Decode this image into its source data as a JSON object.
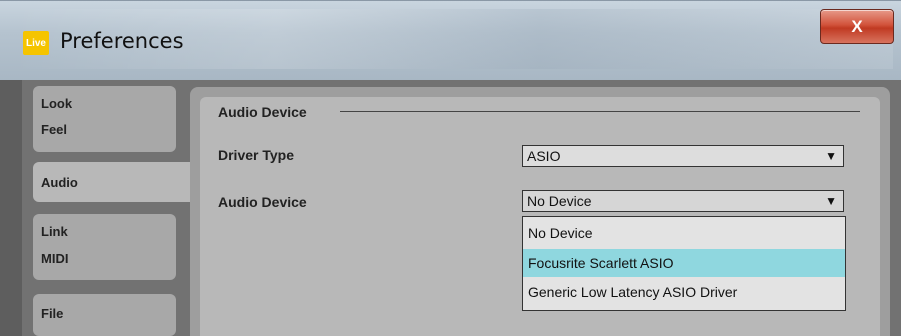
{
  "window": {
    "title": "Preferences",
    "logo_text": "Live",
    "close_label": "X"
  },
  "tabs": [
    {
      "line1": "Look",
      "line2": "Feel"
    },
    {
      "line1": "Audio"
    },
    {
      "line1": "Link",
      "line2": "MIDI"
    },
    {
      "line1": "File"
    }
  ],
  "audio": {
    "section_title": "Audio Device",
    "driver_type_label": "Driver Type",
    "driver_type_value": "ASIO",
    "audio_device_label": "Audio Device",
    "audio_device_value": "No Device",
    "options": [
      "No Device",
      "Focusrite Scarlett ASIO",
      "Generic Low Latency ASIO Driver"
    ],
    "highlighted_option": "Focusrite Scarlett ASIO"
  },
  "colors": {
    "highlight": "#8fd7df",
    "logo": "#f5c400",
    "close": "#c03a22"
  }
}
